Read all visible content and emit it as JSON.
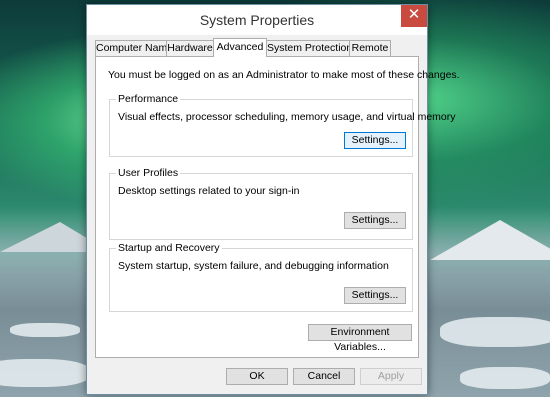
{
  "window": {
    "title": "System Properties",
    "close_glyph": "✕"
  },
  "tabs": [
    {
      "label": "Computer Name",
      "active": false
    },
    {
      "label": "Hardware",
      "active": false
    },
    {
      "label": "Advanced",
      "active": true
    },
    {
      "label": "System Protection",
      "active": false
    },
    {
      "label": "Remote",
      "active": false
    }
  ],
  "advanced": {
    "intro": "You must be logged on as an Administrator to make most of these changes.",
    "performance": {
      "label": "Performance",
      "description": "Visual effects, processor scheduling, memory usage, and virtual memory",
      "button": "Settings..."
    },
    "user_profiles": {
      "label": "User Profiles",
      "description": "Desktop settings related to your sign-in",
      "button": "Settings..."
    },
    "startup_recovery": {
      "label": "Startup and Recovery",
      "description": "System startup, system failure, and debugging information",
      "button": "Settings..."
    },
    "env_button": "Environment Variables..."
  },
  "footer": {
    "ok": "OK",
    "cancel": "Cancel",
    "apply": "Apply"
  },
  "colors": {
    "close_button": "#c94a3e",
    "focus_border": "#0078d7"
  }
}
